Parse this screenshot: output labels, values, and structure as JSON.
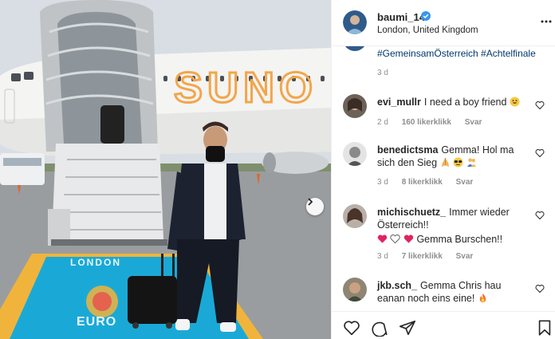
{
  "post": {
    "username": "baumi_14",
    "location": "London, United Kingdom",
    "caption_tail": "#GemeinsamÖsterreich #Achtelfinale",
    "caption_time": "3 d"
  },
  "comments": [
    {
      "user": "evi_mullr",
      "text": "I need a boy friend",
      "emoji": [
        "grinning-face"
      ],
      "time": "2 d",
      "likes": "160 likerklikk",
      "reply": "Svar"
    },
    {
      "user": "benedictsma",
      "text": "Gemma! Hol ma sich den Sieg",
      "emoji": [
        "folded-hands",
        "sunglasses-face",
        "people-hugging"
      ],
      "time": "3 d",
      "likes": "8 likerklikk",
      "reply": "Svar"
    },
    {
      "user": "michischuetz_",
      "text": "Immer wieder Österreich!!",
      "line2": "Gemma Burschen!!",
      "line2_emoji": [
        "red-heart",
        "white-heart",
        "red-heart"
      ],
      "time": "3 d",
      "likes": "7 likerklikk",
      "reply": "Svar"
    },
    {
      "user": "jkb.sch_",
      "text": "Gemma Chris hau eanan noch eins eine!",
      "emoji": [
        "fire"
      ]
    }
  ],
  "photo": {
    "plane_text": "SUNO",
    "carpet_text_1": "LONDON",
    "carpet_text_2": "EURO"
  },
  "colors": {
    "link": "#00376b",
    "verified": "#3897f0",
    "heart": "#ed4956",
    "plane_stripe": "#f2a64a",
    "carpet": "#1aa9d6",
    "carpet_border": "#f0b43c"
  },
  "icons": [
    "verified-badge-icon",
    "more-options-icon",
    "heart-outline-icon",
    "comment-icon",
    "share-icon",
    "bookmark-icon",
    "next-arrow-icon"
  ]
}
